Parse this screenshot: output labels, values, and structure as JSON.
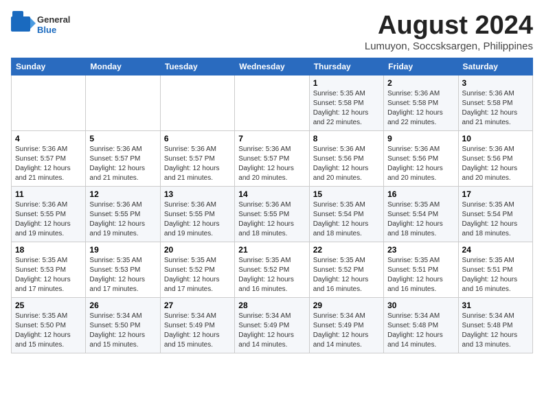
{
  "header": {
    "logo_general": "General",
    "logo_blue": "Blue",
    "title": "August 2024",
    "subtitle": "Lumuyon, Soccsksargen, Philippines"
  },
  "weekdays": [
    "Sunday",
    "Monday",
    "Tuesday",
    "Wednesday",
    "Thursday",
    "Friday",
    "Saturday"
  ],
  "weeks": [
    [
      {
        "day": "",
        "info": ""
      },
      {
        "day": "",
        "info": ""
      },
      {
        "day": "",
        "info": ""
      },
      {
        "day": "",
        "info": ""
      },
      {
        "day": "1",
        "info": "Sunrise: 5:35 AM\nSunset: 5:58 PM\nDaylight: 12 hours\nand 22 minutes."
      },
      {
        "day": "2",
        "info": "Sunrise: 5:36 AM\nSunset: 5:58 PM\nDaylight: 12 hours\nand 22 minutes."
      },
      {
        "day": "3",
        "info": "Sunrise: 5:36 AM\nSunset: 5:58 PM\nDaylight: 12 hours\nand 21 minutes."
      }
    ],
    [
      {
        "day": "4",
        "info": "Sunrise: 5:36 AM\nSunset: 5:57 PM\nDaylight: 12 hours\nand 21 minutes."
      },
      {
        "day": "5",
        "info": "Sunrise: 5:36 AM\nSunset: 5:57 PM\nDaylight: 12 hours\nand 21 minutes."
      },
      {
        "day": "6",
        "info": "Sunrise: 5:36 AM\nSunset: 5:57 PM\nDaylight: 12 hours\nand 21 minutes."
      },
      {
        "day": "7",
        "info": "Sunrise: 5:36 AM\nSunset: 5:57 PM\nDaylight: 12 hours\nand 20 minutes."
      },
      {
        "day": "8",
        "info": "Sunrise: 5:36 AM\nSunset: 5:56 PM\nDaylight: 12 hours\nand 20 minutes."
      },
      {
        "day": "9",
        "info": "Sunrise: 5:36 AM\nSunset: 5:56 PM\nDaylight: 12 hours\nand 20 minutes."
      },
      {
        "day": "10",
        "info": "Sunrise: 5:36 AM\nSunset: 5:56 PM\nDaylight: 12 hours\nand 20 minutes."
      }
    ],
    [
      {
        "day": "11",
        "info": "Sunrise: 5:36 AM\nSunset: 5:55 PM\nDaylight: 12 hours\nand 19 minutes."
      },
      {
        "day": "12",
        "info": "Sunrise: 5:36 AM\nSunset: 5:55 PM\nDaylight: 12 hours\nand 19 minutes."
      },
      {
        "day": "13",
        "info": "Sunrise: 5:36 AM\nSunset: 5:55 PM\nDaylight: 12 hours\nand 19 minutes."
      },
      {
        "day": "14",
        "info": "Sunrise: 5:36 AM\nSunset: 5:55 PM\nDaylight: 12 hours\nand 18 minutes."
      },
      {
        "day": "15",
        "info": "Sunrise: 5:35 AM\nSunset: 5:54 PM\nDaylight: 12 hours\nand 18 minutes."
      },
      {
        "day": "16",
        "info": "Sunrise: 5:35 AM\nSunset: 5:54 PM\nDaylight: 12 hours\nand 18 minutes."
      },
      {
        "day": "17",
        "info": "Sunrise: 5:35 AM\nSunset: 5:54 PM\nDaylight: 12 hours\nand 18 minutes."
      }
    ],
    [
      {
        "day": "18",
        "info": "Sunrise: 5:35 AM\nSunset: 5:53 PM\nDaylight: 12 hours\nand 17 minutes."
      },
      {
        "day": "19",
        "info": "Sunrise: 5:35 AM\nSunset: 5:53 PM\nDaylight: 12 hours\nand 17 minutes."
      },
      {
        "day": "20",
        "info": "Sunrise: 5:35 AM\nSunset: 5:52 PM\nDaylight: 12 hours\nand 17 minutes."
      },
      {
        "day": "21",
        "info": "Sunrise: 5:35 AM\nSunset: 5:52 PM\nDaylight: 12 hours\nand 16 minutes."
      },
      {
        "day": "22",
        "info": "Sunrise: 5:35 AM\nSunset: 5:52 PM\nDaylight: 12 hours\nand 16 minutes."
      },
      {
        "day": "23",
        "info": "Sunrise: 5:35 AM\nSunset: 5:51 PM\nDaylight: 12 hours\nand 16 minutes."
      },
      {
        "day": "24",
        "info": "Sunrise: 5:35 AM\nSunset: 5:51 PM\nDaylight: 12 hours\nand 16 minutes."
      }
    ],
    [
      {
        "day": "25",
        "info": "Sunrise: 5:35 AM\nSunset: 5:50 PM\nDaylight: 12 hours\nand 15 minutes."
      },
      {
        "day": "26",
        "info": "Sunrise: 5:34 AM\nSunset: 5:50 PM\nDaylight: 12 hours\nand 15 minutes."
      },
      {
        "day": "27",
        "info": "Sunrise: 5:34 AM\nSunset: 5:49 PM\nDaylight: 12 hours\nand 15 minutes."
      },
      {
        "day": "28",
        "info": "Sunrise: 5:34 AM\nSunset: 5:49 PM\nDaylight: 12 hours\nand 14 minutes."
      },
      {
        "day": "29",
        "info": "Sunrise: 5:34 AM\nSunset: 5:49 PM\nDaylight: 12 hours\nand 14 minutes."
      },
      {
        "day": "30",
        "info": "Sunrise: 5:34 AM\nSunset: 5:48 PM\nDaylight: 12 hours\nand 14 minutes."
      },
      {
        "day": "31",
        "info": "Sunrise: 5:34 AM\nSunset: 5:48 PM\nDaylight: 12 hours\nand 13 minutes."
      }
    ]
  ]
}
